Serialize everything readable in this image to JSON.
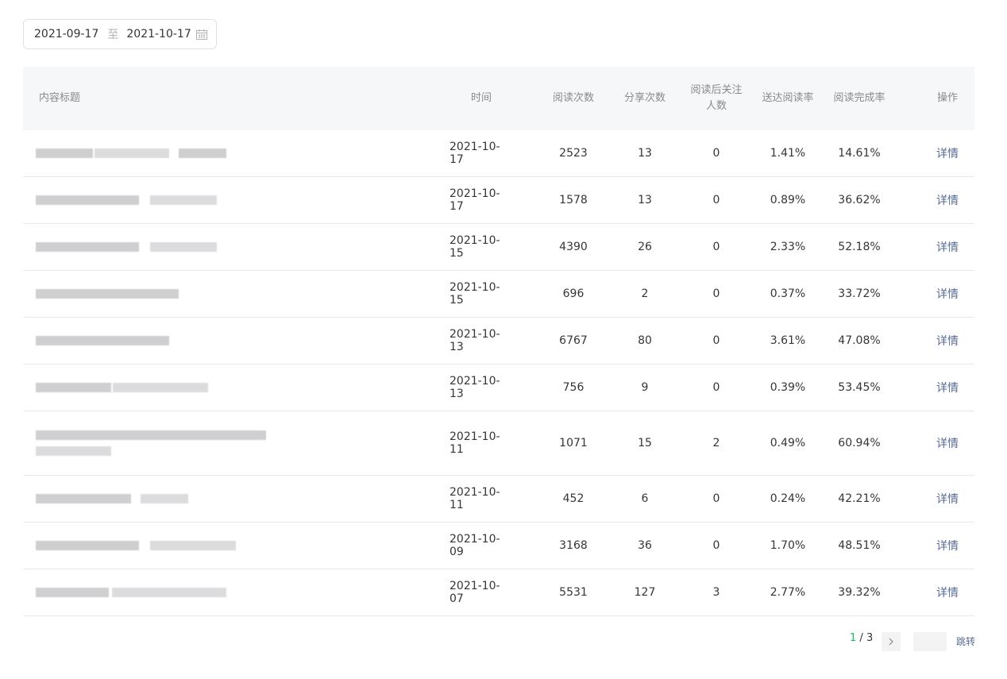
{
  "date_range": {
    "start": "2021-09-17",
    "separator": "至",
    "end": "2021-10-17"
  },
  "columns": {
    "title": "内容标题",
    "time": "时间",
    "reads": "阅读次数",
    "shares": "分享次数",
    "follows_line1": "阅读后关注",
    "follows_line2": "人数",
    "delivery_rate": "送达阅读率",
    "completion_rate": "阅读完成率",
    "action": "操作"
  },
  "rows": [
    {
      "time": "2021-10-17",
      "reads": "2523",
      "shares": "13",
      "follows": "0",
      "delivery_rate": "1.41%",
      "completion_rate": "14.61%",
      "action": "详情"
    },
    {
      "time": "2021-10-17",
      "reads": "1578",
      "shares": "13",
      "follows": "0",
      "delivery_rate": "0.89%",
      "completion_rate": "36.62%",
      "action": "详情"
    },
    {
      "time": "2021-10-15",
      "reads": "4390",
      "shares": "26",
      "follows": "0",
      "delivery_rate": "2.33%",
      "completion_rate": "52.18%",
      "action": "详情"
    },
    {
      "time": "2021-10-15",
      "reads": "696",
      "shares": "2",
      "follows": "0",
      "delivery_rate": "0.37%",
      "completion_rate": "33.72%",
      "action": "详情"
    },
    {
      "time": "2021-10-13",
      "reads": "6767",
      "shares": "80",
      "follows": "0",
      "delivery_rate": "3.61%",
      "completion_rate": "47.08%",
      "action": "详情"
    },
    {
      "time": "2021-10-13",
      "reads": "756",
      "shares": "9",
      "follows": "0",
      "delivery_rate": "0.39%",
      "completion_rate": "53.45%",
      "action": "详情"
    },
    {
      "time": "2021-10-11",
      "reads": "1071",
      "shares": "15",
      "follows": "2",
      "delivery_rate": "0.49%",
      "completion_rate": "60.94%",
      "action": "详情"
    },
    {
      "time": "2021-10-11",
      "reads": "452",
      "shares": "6",
      "follows": "0",
      "delivery_rate": "0.24%",
      "completion_rate": "42.21%",
      "action": "详情"
    },
    {
      "time": "2021-10-09",
      "reads": "3168",
      "shares": "36",
      "follows": "0",
      "delivery_rate": "1.70%",
      "completion_rate": "48.51%",
      "action": "详情"
    },
    {
      "time": "2021-10-07",
      "reads": "5531",
      "shares": "127",
      "follows": "3",
      "delivery_rate": "2.77%",
      "completion_rate": "39.32%",
      "action": "详情"
    }
  ],
  "pagination": {
    "current": "1",
    "separator": " / ",
    "total": "3",
    "next_icon": "chevron-right-icon",
    "jump_label": "跳转"
  },
  "colors": {
    "accent": "#07c160",
    "link": "#576b95",
    "header_bg": "#f6f7f9"
  }
}
